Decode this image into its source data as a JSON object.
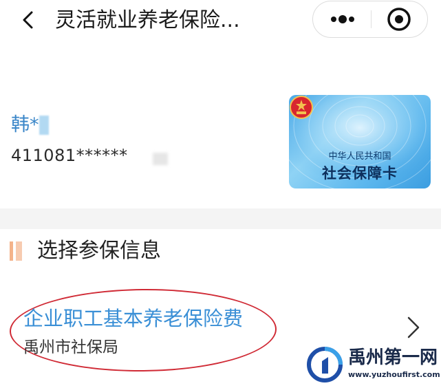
{
  "header": {
    "title": "灵活就业养老保险...",
    "back_icon": "back-chevron-icon",
    "more_icon": "more-dots-icon",
    "target_icon": "close-target-icon"
  },
  "person": {
    "name": "韩*",
    "id_number": "411081******"
  },
  "card": {
    "subtitle": "中华人民共和国",
    "title": "社会保障卡",
    "emblem_icon": "national-emblem-icon",
    "color": "#4aa9e8"
  },
  "section": {
    "title": "选择参保信息",
    "accent_color": "#f4b38a"
  },
  "items": [
    {
      "title": "企业职工基本养老保险费",
      "subtitle": "禹州市社保局",
      "title_color": "#3a8fd6",
      "highlight_color": "#d02a35"
    }
  ],
  "watermark": {
    "name": "禹州第一网",
    "url": "www.yuzhoufirst.com"
  }
}
